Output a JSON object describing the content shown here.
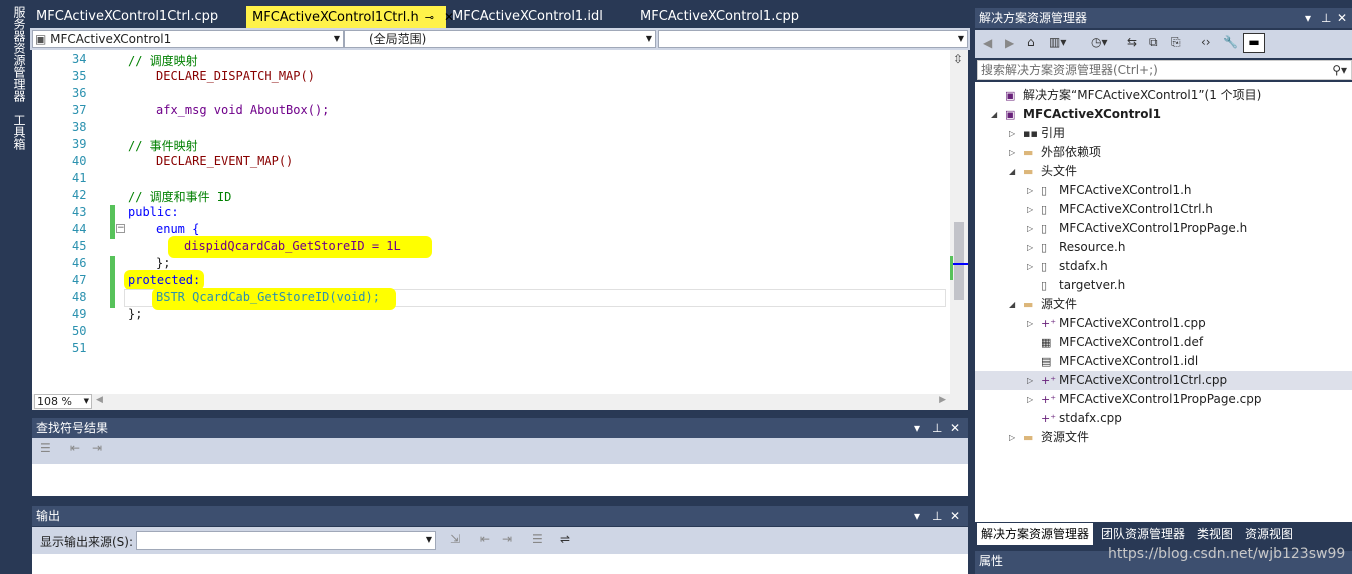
{
  "left_tabs": [
    "服务器资源管理器",
    "工具箱"
  ],
  "tabs": [
    {
      "label": "MFCActiveXControl1Ctrl.cpp",
      "active": false
    },
    {
      "label": "MFCActiveXControl1Ctrl.h",
      "active": true
    },
    {
      "label": "MFCActiveXControl1.idl",
      "active": false
    },
    {
      "label": "MFCActiveXControl1.cpp",
      "active": false
    }
  ],
  "nav": {
    "project": "MFCActiveXControl1",
    "scope": "(全局范围)",
    "member": ""
  },
  "editor": {
    "lines": [
      {
        "n": "34",
        "text": "// 调度映射"
      },
      {
        "n": "35",
        "text": "DECLARE_DISPATCH_MAP()"
      },
      {
        "n": "36",
        "text": ""
      },
      {
        "n": "37",
        "text": "afx_msg void AboutBox();"
      },
      {
        "n": "38",
        "text": ""
      },
      {
        "n": "39",
        "text": "// 事件映射"
      },
      {
        "n": "40",
        "text": "DECLARE_EVENT_MAP()"
      },
      {
        "n": "41",
        "text": ""
      },
      {
        "n": "42",
        "text": "// 调度和事件 ID"
      },
      {
        "n": "43",
        "text": "public:"
      },
      {
        "n": "44",
        "text": "enum {"
      },
      {
        "n": "45",
        "text": "dispidQcardCab_GetStoreID = 1L"
      },
      {
        "n": "46",
        "text": "};"
      },
      {
        "n": "47",
        "text": "protected:"
      },
      {
        "n": "48",
        "text": "BSTR QcardCab_GetStoreID(void);"
      },
      {
        "n": "49",
        "text": "};"
      },
      {
        "n": "50",
        "text": ""
      },
      {
        "n": "51",
        "text": ""
      }
    ],
    "zoom": "108 %"
  },
  "find_symbol": {
    "title": "查找符号结果"
  },
  "output": {
    "title": "输出",
    "source_label": "显示输出来源(S):",
    "source_value": ""
  },
  "solution_explorer": {
    "title": "解决方案资源管理器",
    "search_placeholder": "搜索解决方案资源管理器(Ctrl+;)",
    "tree": [
      {
        "label": "解决方案“MFCActiveXControl1”(1 个项目)",
        "depth": 0,
        "expander": "",
        "icon": "solution-icon",
        "bold": false,
        "selected": false
      },
      {
        "label": "MFCActiveXControl1",
        "depth": 0,
        "expander": "open",
        "icon": "project-icon",
        "bold": true,
        "selected": false
      },
      {
        "label": "引用",
        "depth": 1,
        "expander": "closed",
        "icon": "references-icon",
        "bold": false,
        "selected": false
      },
      {
        "label": "外部依赖项",
        "depth": 1,
        "expander": "closed",
        "icon": "folder-icon",
        "bold": false,
        "selected": false
      },
      {
        "label": "头文件",
        "depth": 1,
        "expander": "open",
        "icon": "folder-icon",
        "bold": false,
        "selected": false
      },
      {
        "label": "MFCActiveXControl1.h",
        "depth": 2,
        "expander": "closed",
        "icon": "header-file-icon",
        "bold": false,
        "selected": false
      },
      {
        "label": "MFCActiveXControl1Ctrl.h",
        "depth": 2,
        "expander": "closed",
        "icon": "header-file-icon",
        "bold": false,
        "selected": false
      },
      {
        "label": "MFCActiveXControl1PropPage.h",
        "depth": 2,
        "expander": "closed",
        "icon": "header-file-icon",
        "bold": false,
        "selected": false
      },
      {
        "label": "Resource.h",
        "depth": 2,
        "expander": "closed",
        "icon": "header-file-icon",
        "bold": false,
        "selected": false
      },
      {
        "label": "stdafx.h",
        "depth": 2,
        "expander": "closed",
        "icon": "header-file-icon",
        "bold": false,
        "selected": false
      },
      {
        "label": "targetver.h",
        "depth": 2,
        "expander": "",
        "icon": "header-file-icon",
        "bold": false,
        "selected": false
      },
      {
        "label": "源文件",
        "depth": 1,
        "expander": "open",
        "icon": "folder-icon",
        "bold": false,
        "selected": false
      },
      {
        "label": "MFCActiveXControl1.cpp",
        "depth": 2,
        "expander": "closed",
        "icon": "cpp-file-icon",
        "bold": false,
        "selected": false
      },
      {
        "label": "MFCActiveXControl1.def",
        "depth": 2,
        "expander": "",
        "icon": "def-file-icon",
        "bold": false,
        "selected": false
      },
      {
        "label": "MFCActiveXControl1.idl",
        "depth": 2,
        "expander": "",
        "icon": "idl-file-icon",
        "bold": false,
        "selected": false
      },
      {
        "label": "MFCActiveXControl1Ctrl.cpp",
        "depth": 2,
        "expander": "closed",
        "icon": "cpp-file-icon",
        "bold": false,
        "selected": true
      },
      {
        "label": "MFCActiveXControl1PropPage.cpp",
        "depth": 2,
        "expander": "closed",
        "icon": "cpp-file-icon",
        "bold": false,
        "selected": false
      },
      {
        "label": "stdafx.cpp",
        "depth": 2,
        "expander": "",
        "icon": "cpp-file-icon",
        "bold": false,
        "selected": false
      },
      {
        "label": "资源文件",
        "depth": 1,
        "expander": "closed",
        "icon": "folder-icon",
        "bold": false,
        "selected": false
      }
    ],
    "bottom_tabs": [
      "解决方案资源管理器",
      "团队资源管理器",
      "类视图",
      "资源视图"
    ]
  },
  "properties": {
    "title": "属性"
  },
  "watermark": "https://blog.csdn.net/wjb123sw99",
  "colors": {
    "highlight": "#ffff00",
    "frame": "#293955",
    "keyword": "#0000ff",
    "comment": "#008000",
    "linenumber": "#2b91af"
  }
}
